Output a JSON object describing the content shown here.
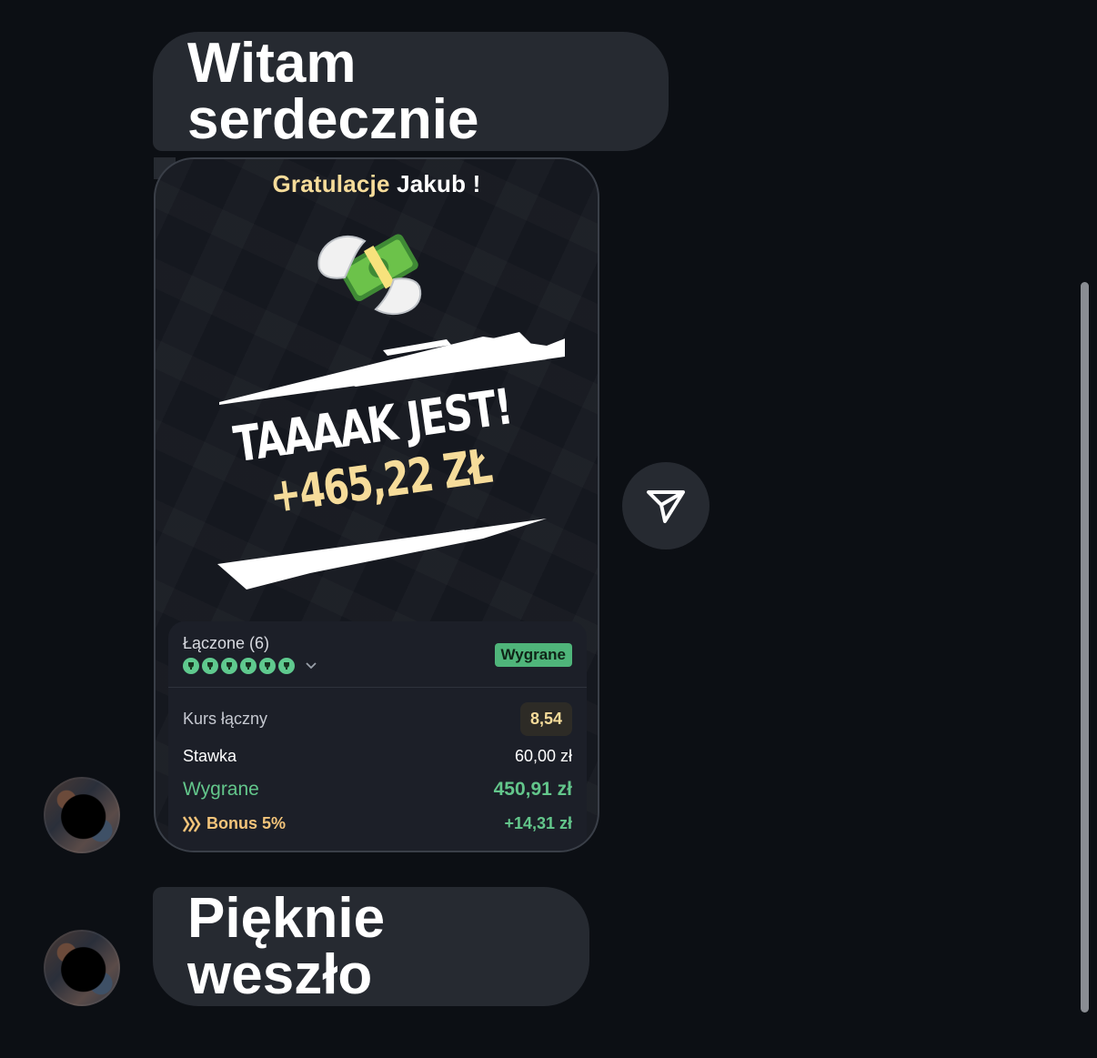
{
  "messages": [
    {
      "text": "Witam serdecznie"
    },
    {
      "text": "Pięknie weszło"
    }
  ],
  "card": {
    "greeting": "Gratulacje",
    "name": "Jakub !",
    "headline": "TAAAAK JEST!",
    "amount": "+465,22 ZŁ",
    "icon": "money-with-wings-icon",
    "bet": {
      "title": "Łączone (6)",
      "legs_count": 6,
      "status": "Wygrane",
      "odds_label": "Kurs łączny",
      "odds_value": "8,54",
      "stake_label": "Stawka",
      "stake_value": "60,00 zł",
      "win_label": "Wygrane",
      "win_value": "450,91 zł",
      "bonus_label": "Bonus 5%",
      "bonus_value": "+14,31 zł"
    }
  },
  "share": {
    "icon": "send-icon"
  },
  "colors": {
    "background": "#0c0f14",
    "bubble": "#262a31",
    "accent_gold": "#f6dc9a",
    "win_green": "#63c68b",
    "bonus_orange": "#f3c47a"
  }
}
